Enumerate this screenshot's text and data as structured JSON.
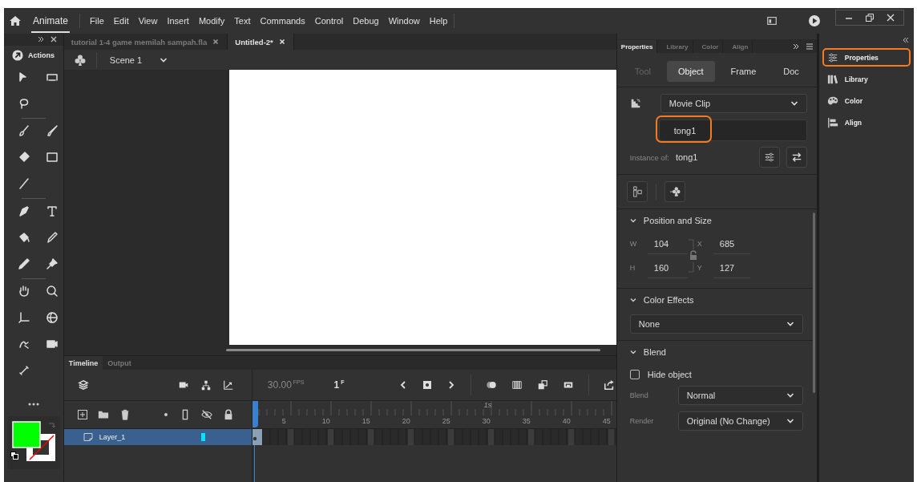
{
  "menubar": {
    "app_name": "Animate",
    "menus": [
      "File",
      "Edit",
      "View",
      "Insert",
      "Modify",
      "Text",
      "Commands",
      "Control",
      "Debug",
      "Window",
      "Help"
    ]
  },
  "toolbar": {
    "actions_label": "Actions"
  },
  "doc_tabs": [
    {
      "label": "tutorial 1-4 game memilah sampah.fla",
      "selected": false
    },
    {
      "label": "Untitled-2*",
      "selected": true
    }
  ],
  "scene": {
    "label": "Scene 1"
  },
  "timeline": {
    "tabs": [
      {
        "label": "Timeline",
        "selected": true
      },
      {
        "label": "Output",
        "selected": false
      }
    ],
    "fps": "30.00",
    "fps_unit": "FPS",
    "frame": "1",
    "frame_unit": "F",
    "seconds_mark": "1s",
    "ruler": [
      "5",
      "10",
      "15",
      "20",
      "25",
      "30",
      "35",
      "40",
      "45"
    ],
    "layers": [
      {
        "name": "Layer_1",
        "selected": true,
        "color": "#00e5ff"
      }
    ]
  },
  "properties": {
    "tabs": [
      {
        "label": "Properties",
        "selected": true
      },
      {
        "label": "Library",
        "selected": false
      },
      {
        "label": "Color",
        "selected": false
      },
      {
        "label": "Align",
        "selected": false
      }
    ],
    "sub_tabs": [
      {
        "label": "Tool",
        "selected": false,
        "disabled": true
      },
      {
        "label": "Object",
        "selected": true,
        "disabled": false
      },
      {
        "label": "Frame",
        "selected": false,
        "disabled": false
      },
      {
        "label": "Doc",
        "selected": false,
        "disabled": false
      }
    ],
    "symbol_type": "Movie Clip",
    "instance_name": "tong1",
    "instance_name_highlighted": true,
    "instance_of_label": "Instance of:",
    "instance_of": "tong1",
    "position": {
      "title": "Position and Size",
      "expanded": true,
      "fields": [
        {
          "label": "W",
          "value": "104"
        },
        {
          "label": "X",
          "value": "685"
        },
        {
          "label": "H",
          "value": "160"
        },
        {
          "label": "Y",
          "value": "127"
        }
      ]
    },
    "color_effects": {
      "title": "Color Effects",
      "expanded": true,
      "value": "None"
    },
    "blend": {
      "title": "Blend",
      "expanded": true,
      "hide_object": {
        "label": "Hide object",
        "checked": false
      },
      "rows": [
        {
          "label": "Blend",
          "value": "Normal"
        },
        {
          "label": "Render",
          "value": "Original (No Change)"
        }
      ]
    }
  },
  "dock": {
    "items": [
      {
        "label": "Properties",
        "highlighted": true
      },
      {
        "label": "Library",
        "highlighted": false
      },
      {
        "label": "Color",
        "highlighted": false
      },
      {
        "label": "Align",
        "highlighted": false
      }
    ]
  }
}
